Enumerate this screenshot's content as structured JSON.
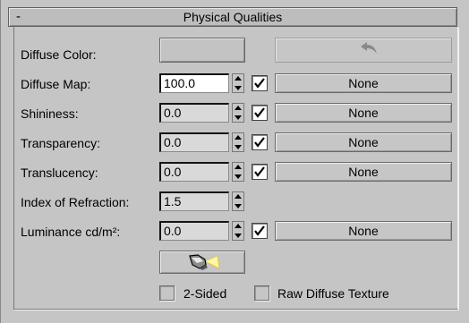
{
  "rollout": {
    "collapse_sign": "-",
    "title": "Physical Qualities"
  },
  "params": {
    "diffuse_color": {
      "label": "Diffuse Color:",
      "undo_icon": "undo-arrow-icon"
    },
    "diffuse_map": {
      "label": "Diffuse Map:",
      "value": "100.0",
      "enabled": true,
      "map_button": "None"
    },
    "shininess": {
      "label": "Shininess:",
      "value": "0.0",
      "enabled": true,
      "map_button": "None"
    },
    "transparency": {
      "label": "Transparency:",
      "value": "0.0",
      "enabled": true,
      "map_button": "None"
    },
    "translucency": {
      "label": "Translucency:",
      "value": "0.0",
      "enabled": true,
      "map_button": "None"
    },
    "ior": {
      "label": "Index of Refraction:",
      "value": "1.5"
    },
    "luminance": {
      "label": "Luminance cd/m²:",
      "value": "0.0",
      "enabled": true,
      "map_button": "None"
    },
    "luminance_picker_icon": "flashlight-icon"
  },
  "options": {
    "two_sided": {
      "label": "2-Sided",
      "checked": false
    },
    "raw_diffuse": {
      "label": "Raw Diffuse Texture",
      "checked": false
    }
  },
  "colors": {
    "panel_bg": "#c5c5c5",
    "active_field_bg": "#ffffff",
    "inactive_field_bg": "#d9d9d9",
    "flashlight_beam": "#fff7a0"
  }
}
